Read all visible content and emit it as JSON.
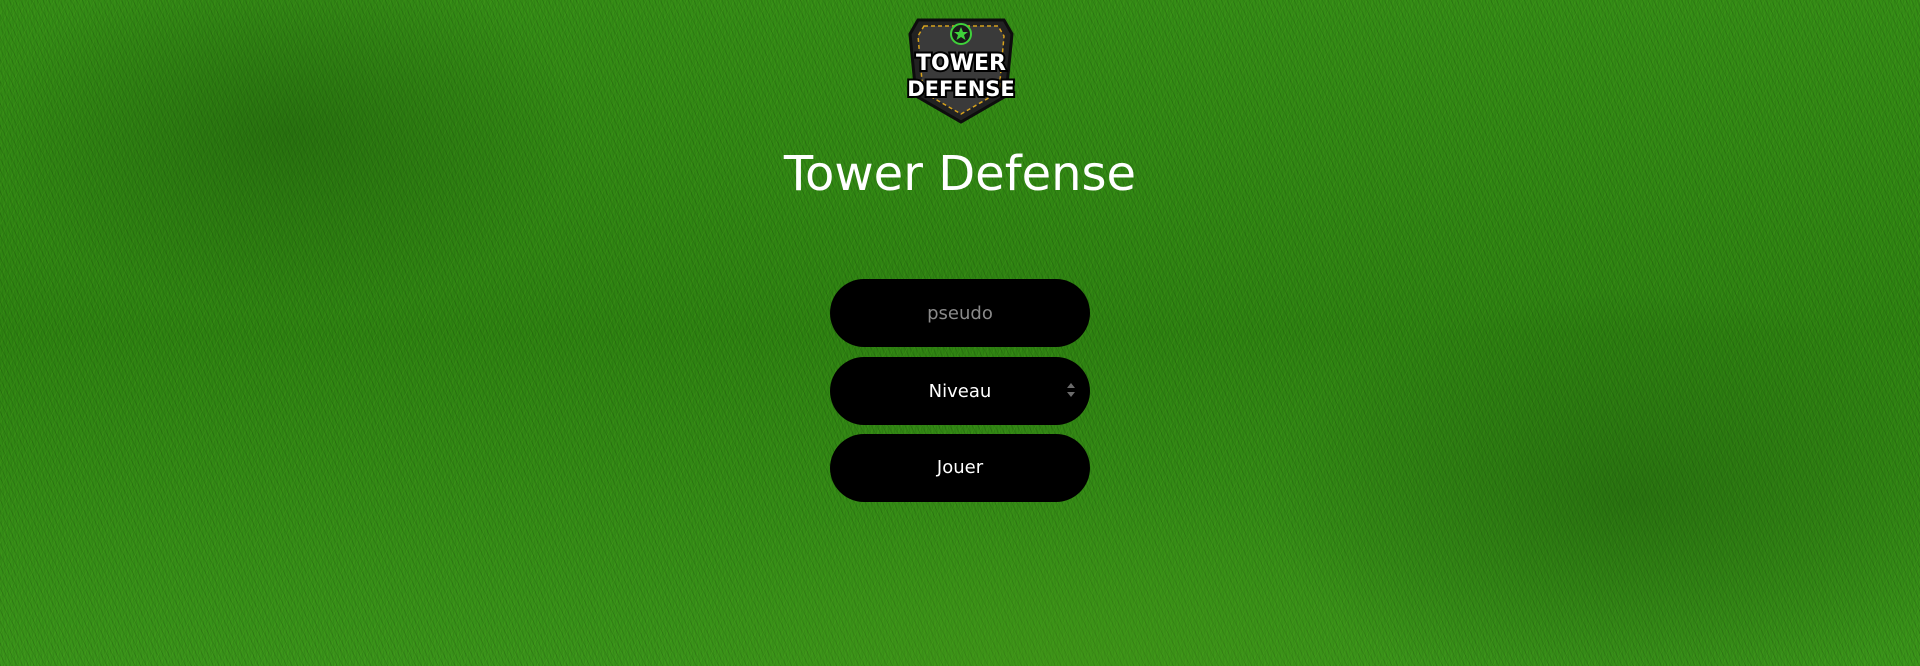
{
  "logo": {
    "text_line1": "TOWER",
    "text_line2": "DEFENSE",
    "icon": "star-shield-emblem",
    "accent_color": "#3fd13a"
  },
  "title": "Tower Defense",
  "form": {
    "pseudo_placeholder": "pseudo",
    "pseudo_value": "",
    "level_selected": "Niveau",
    "play_label": "Jouer"
  },
  "colors": {
    "background": "#2f8a12",
    "control_bg": "#000000",
    "text": "#ffffff",
    "placeholder": "#8a8a8a"
  }
}
